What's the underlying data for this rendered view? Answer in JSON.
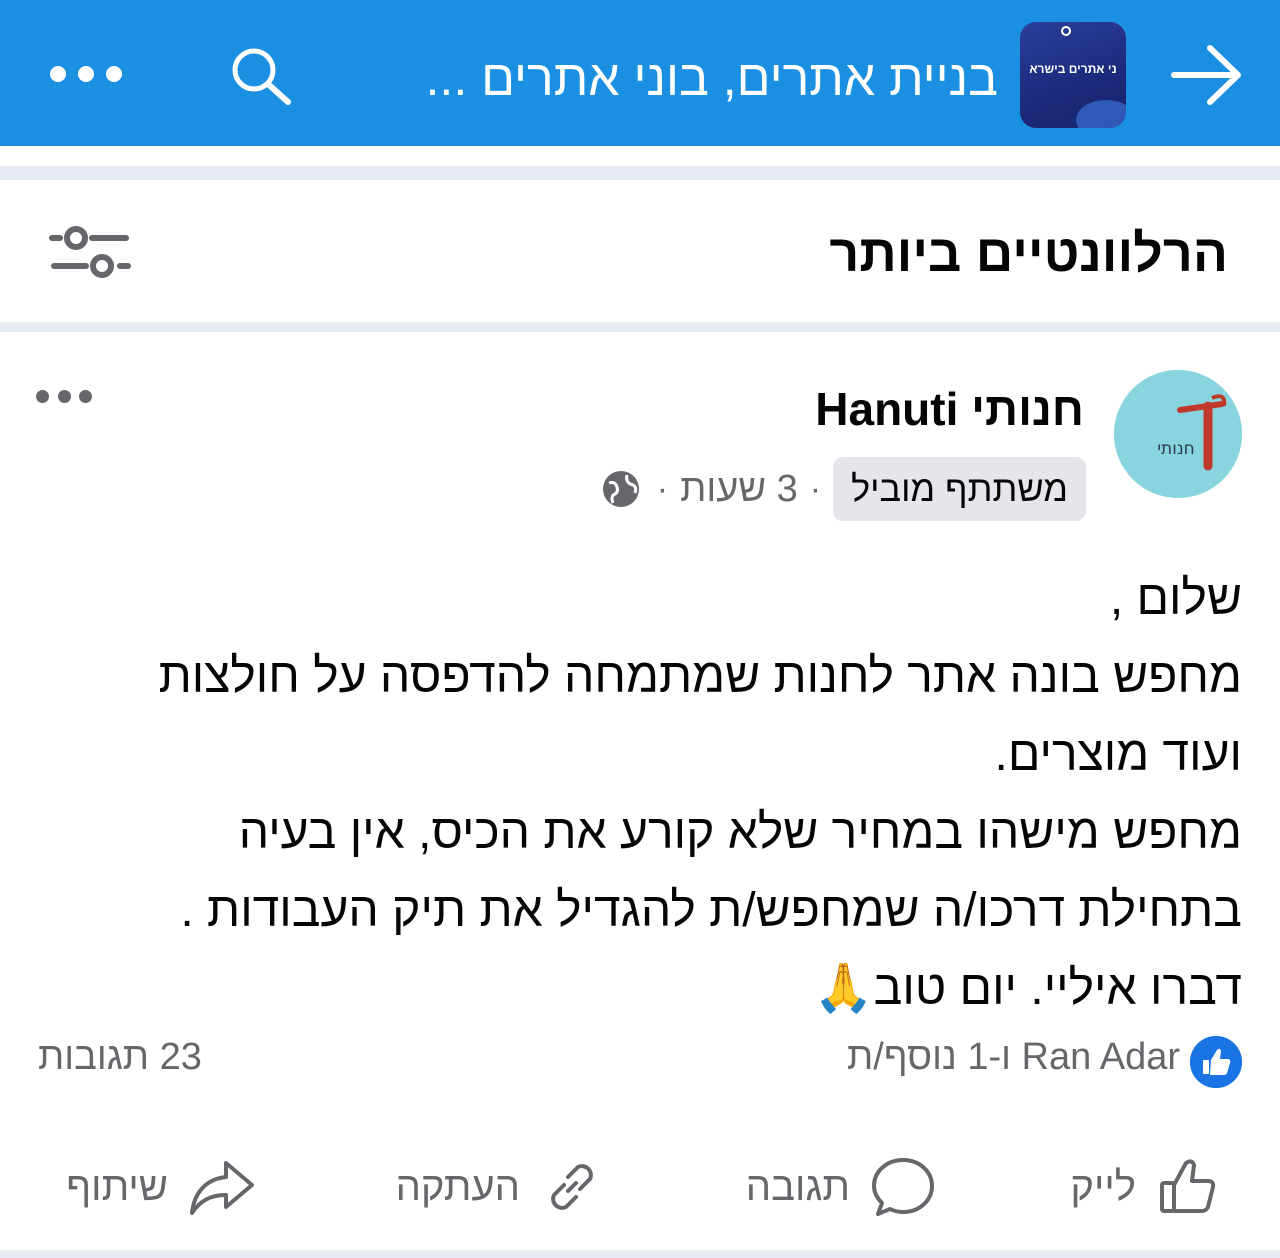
{
  "topbar": {
    "title": "בניית אתרים, בוני אתרים ...",
    "group_thumb_text": "ני אתרים בישרא",
    "color": "#1b8fe1"
  },
  "feed": {
    "sort_label": "הרלוונטיים ביותר"
  },
  "post": {
    "author": "חנותי Hanuti",
    "avatar_text": "חנותי",
    "badge": "משתתף מוביל",
    "time": "3 שעות",
    "separator": "·",
    "body_lines": [
      "שלום ,",
      "מחפש בונה אתר לחנות שמתמחה להדפסה על חולצות",
      "ועוד מוצרים.",
      "מחפש מישהו במחיר שלא קורע את הכיס, אין בעיה",
      "בתחילת דרכו/ה שמחפש/ת להגדיל את תיק העבודות .",
      "דברו איליי. יום טוב🙏"
    ],
    "reactions_text": "Ran Adar ו-1 נוסף/ת",
    "comments_text": "23 תגובות",
    "actions": {
      "like": "לייק",
      "comment": "תגובה",
      "copy": "העתקה",
      "share": "שיתוף"
    }
  },
  "icons": {
    "back": "arrow-right-icon",
    "search": "search-icon",
    "more": "more-horizontal-icon",
    "filter": "filter-sliders-icon",
    "globe": "globe-icon",
    "like_reaction": "thumbs-up-reaction-icon"
  },
  "colors": {
    "accent": "#1b74e4",
    "muted_text": "#65676b",
    "separator": "#e6ebf2"
  }
}
